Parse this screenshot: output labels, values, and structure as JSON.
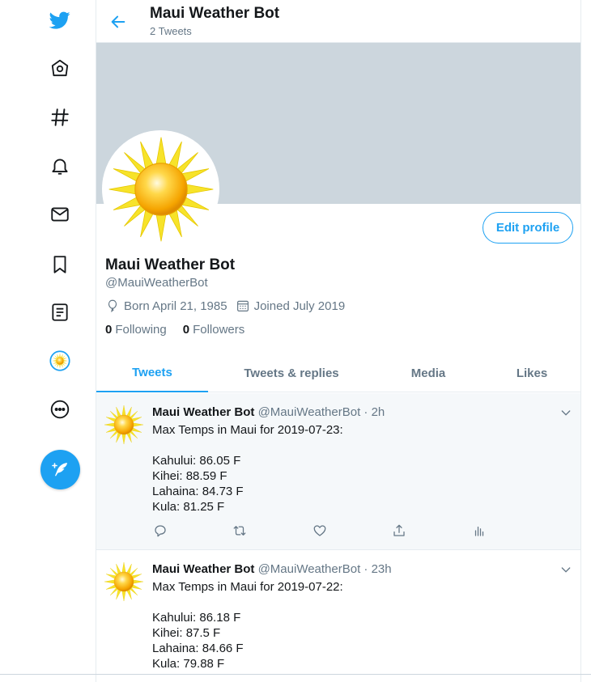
{
  "nav": {
    "items": [
      "twitter-logo",
      "home",
      "explore",
      "notifications",
      "messages",
      "bookmarks",
      "lists",
      "profile",
      "more"
    ],
    "compose_label": "Tweet"
  },
  "header": {
    "title": "Maui Weather Bot",
    "subtitle": "2 Tweets"
  },
  "profile": {
    "name": "Maui Weather Bot",
    "handle": "@MauiWeatherBot",
    "born": "Born April 21, 1985",
    "joined": "Joined July 2019",
    "following_count": "0",
    "following_label": "Following",
    "followers_count": "0",
    "followers_label": "Followers",
    "edit_label": "Edit profile"
  },
  "tabs": [
    "Tweets",
    "Tweets & replies",
    "Media",
    "Likes"
  ],
  "tweets": [
    {
      "name": "Maui Weather Bot",
      "meta": "@MauiWeatherBot · 2h",
      "lines": [
        "Max Temps in Maui for 2019-07-23:",
        "",
        "Kahului: 86.05 F",
        "Kihei: 88.59 F",
        "Lahaina: 84.73 F",
        "Kula: 81.25 F"
      ]
    },
    {
      "name": "Maui Weather Bot",
      "meta": "@MauiWeatherBot · 23h",
      "lines": [
        "Max Temps in Maui for 2019-07-22:",
        "",
        "Kahului: 86.18 F",
        "Kihei: 87.5 F",
        "Lahaina: 84.66 F",
        "Kula: 79.88 F"
      ]
    }
  ],
  "colors": {
    "accent": "#1da1f2",
    "banner": "#ccd6dd",
    "secondary_text": "#657786"
  }
}
